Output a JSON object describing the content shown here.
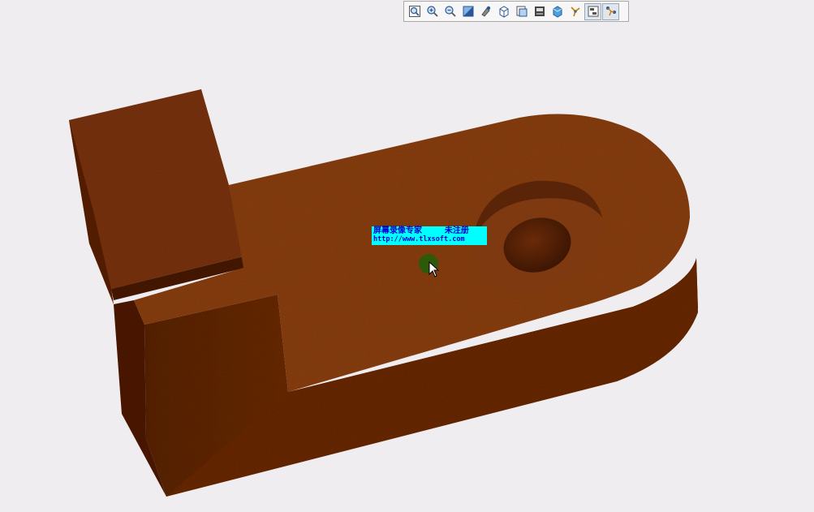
{
  "app": {
    "background_color": "#efedef",
    "model_color": "#8a3f14"
  },
  "toolbar": {
    "buttons": [
      {
        "name": "zoom-to-fit",
        "icon": "zoom-fit-icon"
      },
      {
        "name": "zoom-in",
        "icon": "zoom-in-icon"
      },
      {
        "name": "zoom-out",
        "icon": "zoom-out-icon"
      },
      {
        "name": "section-view",
        "icon": "section-view-icon"
      },
      {
        "name": "rotate-view",
        "icon": "rotate-view-icon"
      },
      {
        "name": "view-orientation",
        "icon": "view-cube-icon"
      },
      {
        "name": "display-style",
        "icon": "display-style-icon"
      },
      {
        "name": "hide-show-items",
        "icon": "hide-show-icon"
      },
      {
        "name": "apply-scene",
        "icon": "scene-icon"
      },
      {
        "name": "view-settings",
        "icon": "view-settings-icon"
      },
      {
        "name": "realview-graphics",
        "icon": "realview-icon",
        "active": true
      },
      {
        "name": "shadows-mode",
        "icon": "shadows-icon",
        "active": true
      }
    ]
  },
  "watermark": {
    "line1": "屏幕录像专家        未注册",
    "line2": "http://www.tlxsoft.com",
    "background": "#00ffff",
    "text_color": "#0000cc"
  }
}
